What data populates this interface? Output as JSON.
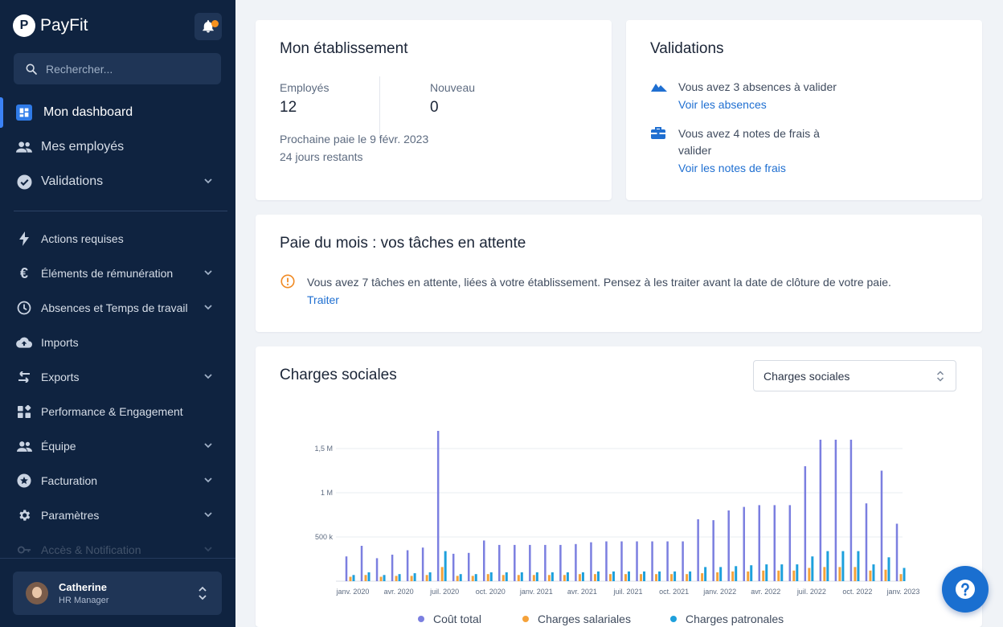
{
  "app": {
    "brand": "PayFit"
  },
  "search": {
    "placeholder": "Rechercher..."
  },
  "sidebar": {
    "main_items": [
      {
        "label": "Mon dashboard",
        "icon": "dashboard-icon"
      },
      {
        "label": "Mes employés",
        "icon": "people-icon"
      },
      {
        "label": "Validations",
        "icon": "check-circle-icon"
      }
    ],
    "items": [
      {
        "label": "Actions requises",
        "icon": "bolt-icon"
      },
      {
        "label": "Éléments de rémunération",
        "icon": "euro-icon"
      },
      {
        "label": "Absences et Temps de travail",
        "icon": "clock-icon"
      },
      {
        "label": "Imports",
        "icon": "cloud-upload-icon"
      },
      {
        "label": "Exports",
        "icon": "swap-icon"
      },
      {
        "label": "Performance & Engagement",
        "icon": "widgets-icon"
      },
      {
        "label": "Équipe",
        "icon": "people-icon"
      },
      {
        "label": "Facturation",
        "icon": "star-icon"
      },
      {
        "label": "Paramètres",
        "icon": "gear-icon"
      },
      {
        "label": "Accès & Notification",
        "icon": "key-icon"
      }
    ]
  },
  "user": {
    "name": "Catherine",
    "role": "HR Manager"
  },
  "etablissement": {
    "title": "Mon établissement",
    "employes_label": "Employés",
    "employes_value": "12",
    "nouveau_label": "Nouveau",
    "nouveau_value": "0",
    "prochaine_paie": "Prochaine paie le 9 févr. 2023",
    "jours_restants": "24 jours restants"
  },
  "validations": {
    "title": "Validations",
    "absences_text": "Vous avez 3 absences à valider",
    "absences_link": "Voir les absences",
    "notes_text_1": "Vous avez 4 notes de frais à",
    "notes_text_2": "valider",
    "notes_link": "Voir les notes de frais"
  },
  "paie": {
    "title": "Paie du mois : vos tâches en attente",
    "message": "Vous avez 7 tâches en attente, liées à votre établissement. Pensez à les traiter avant la date de clôture de votre paie.",
    "action": "Traiter"
  },
  "charges": {
    "title": "Charges sociales",
    "select_value": "Charges sociales"
  },
  "chart_data": {
    "type": "bar",
    "x": [
      "janv. 2020",
      "févr. 2020",
      "mars 2020",
      "avr. 2020",
      "mai 2020",
      "juin 2020",
      "juil. 2020",
      "août 2020",
      "sept. 2020",
      "oct. 2020",
      "nov. 2020",
      "déc. 2020",
      "janv. 2021",
      "févr. 2021",
      "mars 2021",
      "avr. 2021",
      "mai 2021",
      "juin 2021",
      "juil. 2021",
      "août 2021",
      "sept. 2021",
      "oct. 2021",
      "nov. 2021",
      "déc. 2021",
      "janv. 2022",
      "févr. 2022",
      "mars 2022",
      "avr. 2022",
      "mai 2022",
      "juin 2022",
      "juil. 2022",
      "août 2022",
      "sept. 2022",
      "oct. 2022",
      "nov. 2022",
      "déc. 2022",
      "janv. 2023"
    ],
    "tick_labels": [
      "janv. 2020",
      "avr. 2020",
      "juil. 2020",
      "oct. 2020",
      "janv. 2021",
      "avr. 2021",
      "juil. 2021",
      "oct. 2021",
      "janv. 2022",
      "avr. 2022",
      "juil. 2022",
      "oct. 2022",
      "janv. 2023"
    ],
    "y_ticks": [
      {
        "value": 500000,
        "label": "500 k"
      },
      {
        "value": 1000000,
        "label": "1 M"
      },
      {
        "value": 1500000,
        "label": "1,5 M"
      }
    ],
    "ylim": [
      0,
      1750000
    ],
    "series": [
      {
        "name": "Coût total",
        "color": "#7b7fe0",
        "values": [
          280000,
          400000,
          260000,
          300000,
          350000,
          380000,
          1700000,
          310000,
          320000,
          460000,
          410000,
          410000,
          410000,
          410000,
          410000,
          420000,
          440000,
          450000,
          450000,
          450000,
          450000,
          450000,
          450000,
          700000,
          690000,
          800000,
          840000,
          860000,
          860000,
          860000,
          1300000,
          1600000,
          1600000,
          1600000,
          880000,
          1250000,
          650000
        ]
      },
      {
        "name": "Charges salariales",
        "color": "#f5a23a",
        "values": [
          50000,
          70000,
          50000,
          60000,
          60000,
          70000,
          160000,
          60000,
          60000,
          80000,
          70000,
          70000,
          70000,
          70000,
          70000,
          80000,
          80000,
          80000,
          80000,
          80000,
          80000,
          80000,
          80000,
          90000,
          100000,
          110000,
          110000,
          120000,
          120000,
          120000,
          150000,
          160000,
          160000,
          160000,
          120000,
          130000,
          80000
        ]
      },
      {
        "name": "Charges patronales",
        "color": "#1ea0dc",
        "values": [
          70000,
          100000,
          70000,
          80000,
          90000,
          100000,
          340000,
          80000,
          80000,
          100000,
          100000,
          100000,
          100000,
          100000,
          100000,
          100000,
          110000,
          110000,
          110000,
          110000,
          110000,
          110000,
          110000,
          160000,
          160000,
          170000,
          180000,
          190000,
          190000,
          190000,
          280000,
          340000,
          340000,
          340000,
          190000,
          270000,
          150000
        ]
      }
    ],
    "legend_position": "bottom",
    "grid": true
  }
}
